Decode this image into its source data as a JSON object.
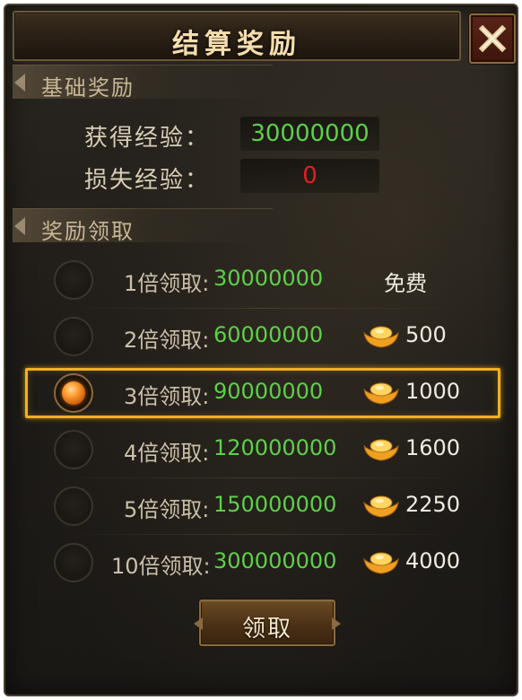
{
  "window": {
    "title": "结算奖励",
    "close_icon": "close-x-icon"
  },
  "basic_reward": {
    "header": "基础奖励",
    "gained_exp_label": "获得经验：",
    "gained_exp_value": "30000000",
    "lost_exp_label": "损失经验：",
    "lost_exp_value": "0"
  },
  "reward_claim": {
    "header": "奖励领取",
    "selected_index": 2,
    "options": [
      {
        "label": "1倍领取:",
        "amount": "30000000",
        "cost": "免费",
        "free": true
      },
      {
        "label": "2倍领取:",
        "amount": "60000000",
        "cost": "500",
        "free": false
      },
      {
        "label": "3倍领取:",
        "amount": "90000000",
        "cost": "1000",
        "free": false
      },
      {
        "label": "4倍领取:",
        "amount": "120000000",
        "cost": "1600",
        "free": false
      },
      {
        "label": "5倍领取:",
        "amount": "150000000",
        "cost": "2250",
        "free": false
      },
      {
        "label": "10倍领取:",
        "amount": "300000000",
        "cost": "4000",
        "free": false
      }
    ],
    "currency_icon": "gold-ingot-icon"
  },
  "claim_button": {
    "label": "领取"
  },
  "colors": {
    "value_green": "#5ed04a",
    "value_red": "#e02020",
    "selection_gold": "#f0b020",
    "title_text": "#f4deb0"
  }
}
